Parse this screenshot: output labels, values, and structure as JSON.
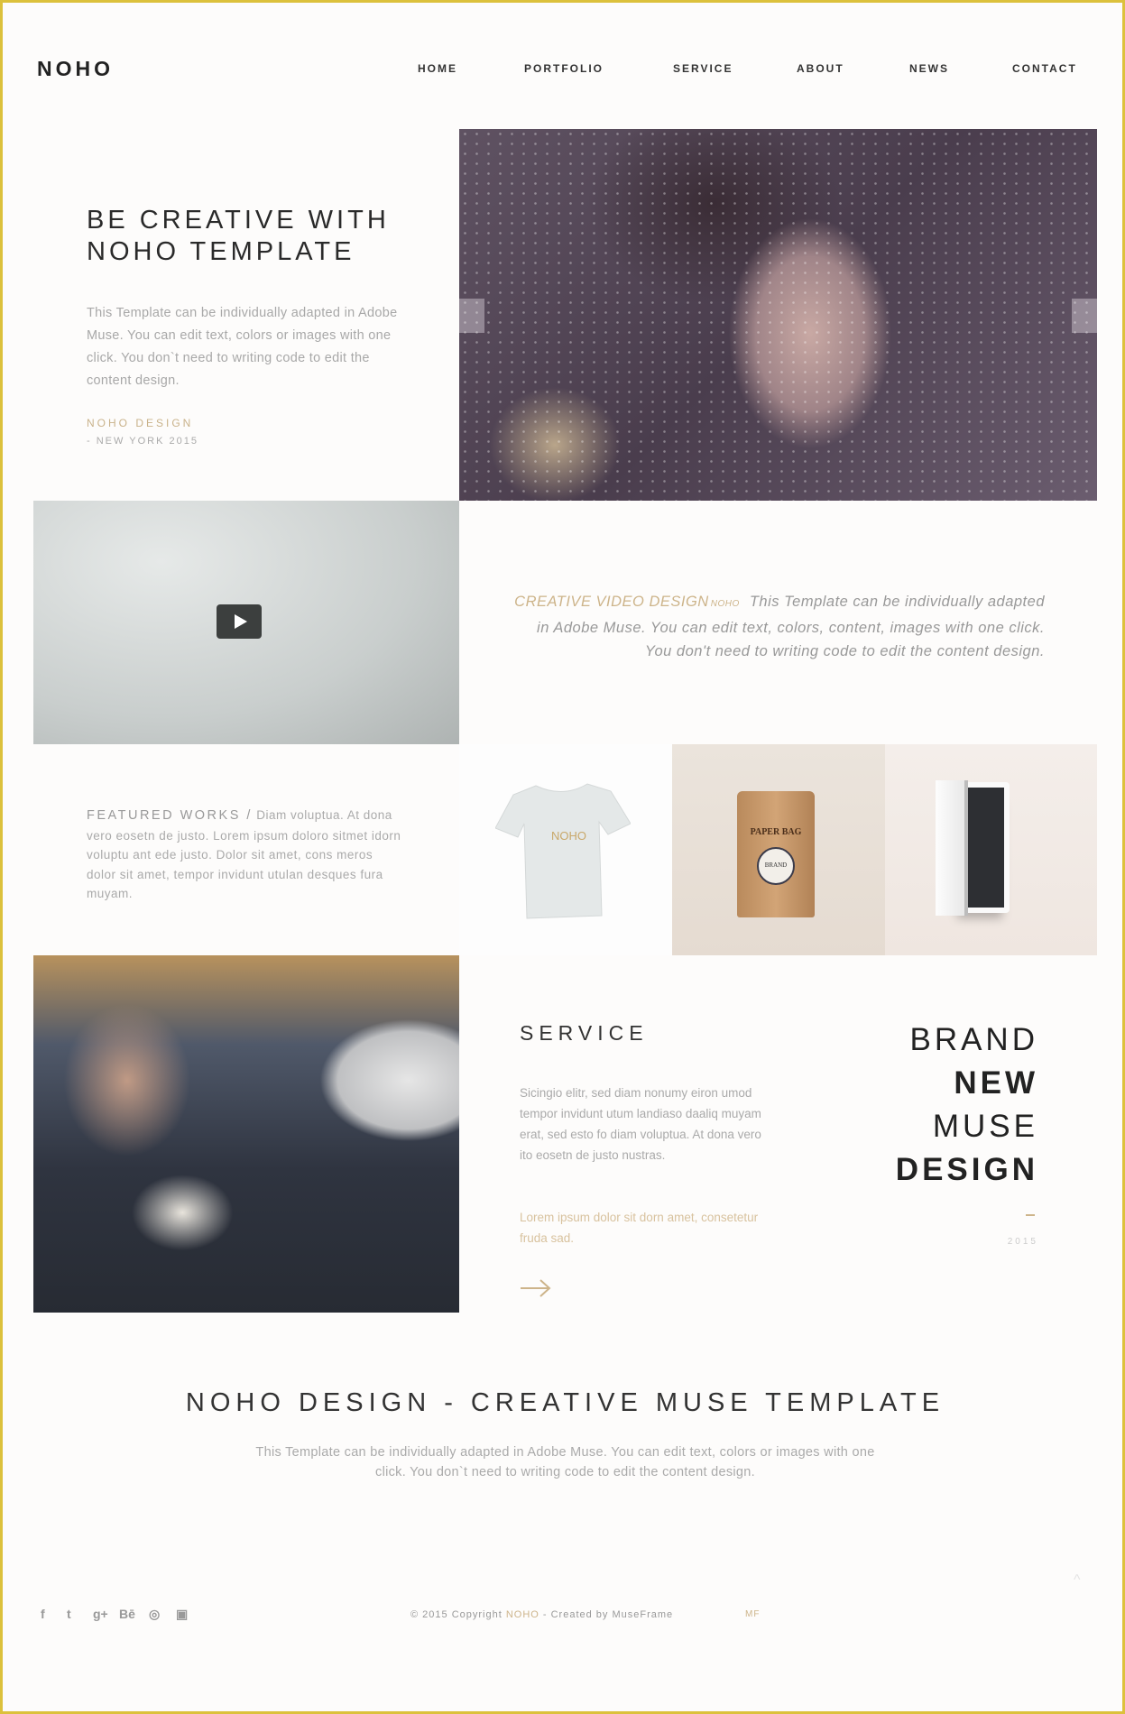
{
  "header": {
    "logo": "NOHO",
    "nav": [
      "HOME",
      "PORTFOLIO",
      "SERVICE",
      "ABOUT",
      "NEWS",
      "CONTACT"
    ]
  },
  "hero": {
    "title_line1": "BE CREATIVE WITH",
    "title_line2": "NOHO TEMPLATE",
    "body": "This Template can be individually adapted in Adobe Muse. You can edit text, colors or images with one click. You don`t need to writing code to edit the content design.",
    "tag": "NOHO DESIGN",
    "location": "- NEW YORK 2015"
  },
  "video": {
    "highlight": "CREATIVE VIDEO DESIGN",
    "small": "NOHO",
    "text": "This Template can be individually adapted in Adobe Muse. You can edit text, colors, content, images with one click. You don't need to writing code to edit the content design."
  },
  "featured": {
    "heading": "FEATURED WORKS /",
    "text": "Diam voluptua. At dona vero eosetn de justo. Lorem ipsum doloro sitmet idorn voluptu ant ede justo. Dolor sit amet, cons meros dolor sit amet, tempor invidunt utulan desques fura muyam."
  },
  "products": {
    "tshirt_text": "NOHO",
    "bag_text": "PAPER BAG",
    "bag_badge": "BRAND"
  },
  "service": {
    "title": "SERVICE",
    "body": "Sicingio elitr, sed diam nonumy eiron umod tempor invidunt utum landiaso daaliq muyam erat, sed esto fo diam voluptua. At dona vero ito eosetn de justo nustras.",
    "highlight": "Lorem ipsum dolor sit dorn amet, consetetur fruda sad."
  },
  "brand": {
    "lines": [
      "BRAND",
      "NEW",
      "MUSE",
      "DESIGN"
    ],
    "year": "2015"
  },
  "footer": {
    "title": "NOHO DESIGN - CREATIVE MUSE TEMPLATE",
    "body": "This Template can be individually adapted in Adobe Muse. You can edit text, colors or images with one click. You don`t need to writing code to edit the content design.",
    "copy_prefix": "© 2015 Copyright",
    "copy_brand": "NOHO",
    "copy_suffix": "- Created by MuseFrame",
    "mf": "MF",
    "to_top": "^",
    "social": [
      "f",
      "t",
      "g+",
      "Bē",
      "◎",
      "▣"
    ]
  },
  "colors": {
    "accent": "#cdb48a",
    "border": "#dcc13c",
    "text": "#222222"
  }
}
